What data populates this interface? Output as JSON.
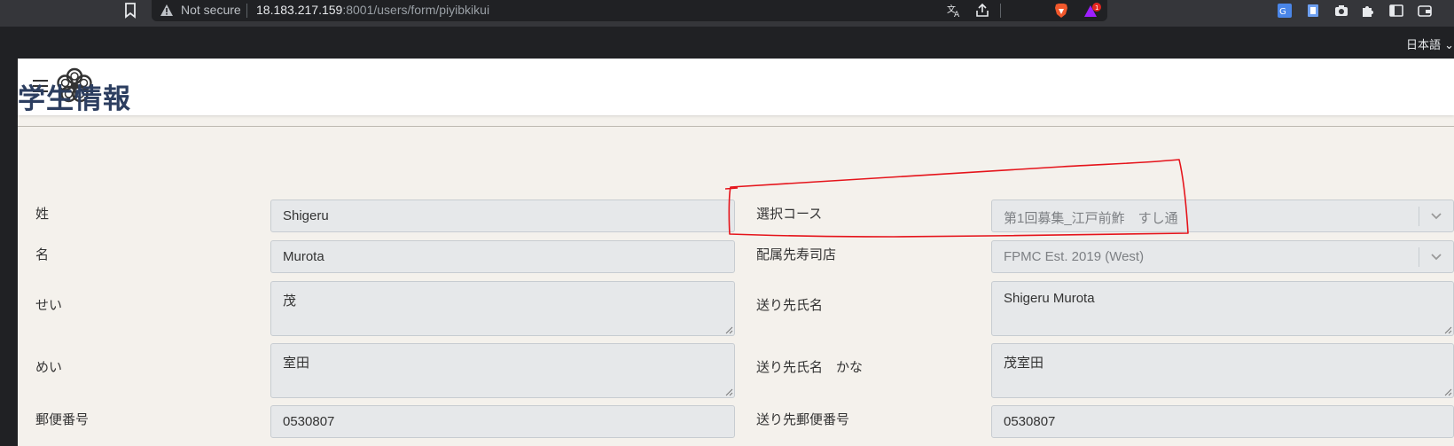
{
  "browser": {
    "security_text": "Not secure",
    "url_host": "18.183.217.159",
    "url_rest": ":8001/users/form/piyibkikui",
    "rewards_badge": "1",
    "language": "日本語"
  },
  "page": {
    "title": "学生情報"
  },
  "form": {
    "left": [
      {
        "label": "姓",
        "value": "Shigeru"
      },
      {
        "label": "名",
        "value": "Murota"
      },
      {
        "label": "せい",
        "value": "茂"
      },
      {
        "label": "めい",
        "value": "室田"
      },
      {
        "label": "郵便番号",
        "value": "0530807"
      }
    ],
    "right": [
      {
        "label": "選択コース",
        "value": "第1回募集_江戸前鮓　すし通"
      },
      {
        "label": "配属先寿司店",
        "value": "FPMC Est. 2019 (West)"
      },
      {
        "label": "送り先氏名",
        "value": "Shigeru Murota"
      },
      {
        "label": "送り先氏名　かな",
        "value": "茂室田"
      },
      {
        "label": "送り先郵便番号",
        "value": "0530807"
      }
    ]
  },
  "colors": {
    "title": "#2c3e60",
    "annotation": "#e5141b",
    "page_bg": "#f4f1ec"
  }
}
